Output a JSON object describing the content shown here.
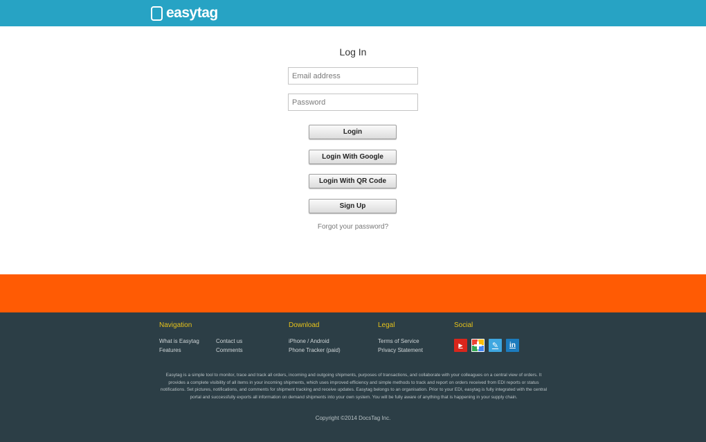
{
  "header": {
    "logo_text": "easytag"
  },
  "login": {
    "title": "Log In",
    "email_placeholder": "Email address",
    "password_placeholder": "Password",
    "login_label": "Login",
    "google_label": "Login With Google",
    "qr_label": "Login With QR Code",
    "signup_label": "Sign Up",
    "forgot_label": "Forgot your password?"
  },
  "footer": {
    "navigation": {
      "heading": "Navigation",
      "links": [
        "What is Easytag",
        "Features",
        "Contact us",
        "Comments"
      ]
    },
    "download": {
      "heading": "Download",
      "links": [
        "iPhone / Android",
        "Phone Tracker (paid)"
      ]
    },
    "legal": {
      "heading": "Legal",
      "links": [
        "Terms of Service",
        "Privacy Statement"
      ]
    },
    "social": {
      "heading": "Social",
      "icons": [
        "youtube-icon",
        "google-plus-icon",
        "blog-icon",
        "linkedin-icon"
      ],
      "icon_glyphs": {
        "youtube": "▶",
        "gplus": "+",
        "blog": "✎",
        "linkedin": "in"
      }
    },
    "about": "Easytag is a simple tool to monitor, trace and track all orders, incoming and outgoing shipments, purposes of transactions, and collaborate with your colleagues on a central view of orders. It provides a complete visibility of all items in your incoming shipments, which uses improved efficiency and simple methods to track and report on orders received from EDI reports or status notifications. Set pictures, notifications, and comments for shipment tracking and receive updates. Easytag belongs to an organisation. Prior to your EDI, easytag is fully integrated with the central portal and successfully exports all information on demand shipments into your own system. You will be fully aware of anything that is happening in your supply chain.",
    "copyright": "Copyright ©2014 DocsTag Inc."
  },
  "colors": {
    "topbar": "#27a3c4",
    "orange_band": "#ff5b04",
    "footer_bg": "#2c3e46",
    "footer_heading": "#e6c21a"
  }
}
